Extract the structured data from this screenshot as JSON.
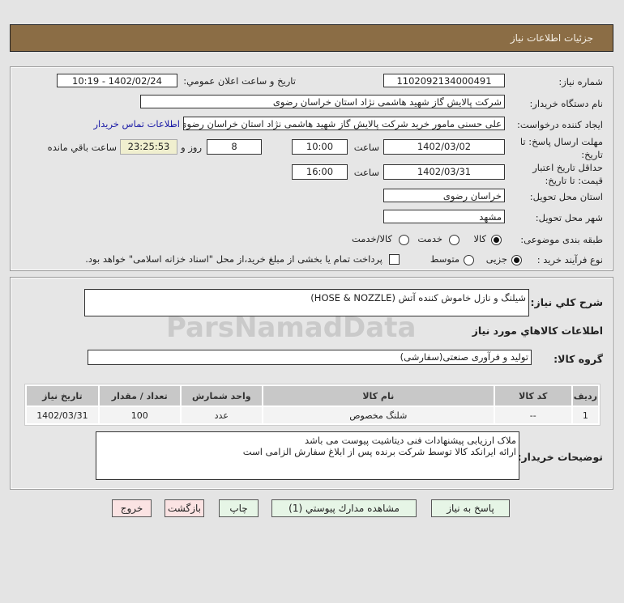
{
  "header": {
    "title": "جزئیات اطلاعات نیاز"
  },
  "watermark": "ParsNamadData",
  "form": {
    "need_number_label": "شماره نیاز:",
    "need_number": "1102092134000491",
    "announce_label": "تاریخ و ساعت اعلان عمومي:",
    "announce_value": "1402/02/24 - 10:19",
    "buyer_org_label": "نام دستگاه خریدار:",
    "buyer_org": "شرکت پالایش گاز شهید هاشمی نژاد   استان خراسان رضوی",
    "creator_label": "ایجاد کننده درخواست:",
    "creator": "علی حسنی مامور خرید شرکت پالایش گاز شهید هاشمی نژاد   استان خراسان رضوی",
    "contact_link": "اطلاعات تماس خریدار",
    "deadline_label_1": "مهلت ارسال پاسخ: تا",
    "deadline_label_2": "تاریخ:",
    "deadline_date": "1402/03/02",
    "time_label": "ساعت",
    "deadline_time": "10:00",
    "days": "8",
    "days_label": "روز و",
    "remaining": "23:25:53",
    "remaining_label": "ساعت باقي مانده",
    "validity_label_1": "حداقل تاریخ اعتبار",
    "validity_label_2": "قیمت: تا تاریخ:",
    "validity_date": "1402/03/31",
    "validity_time": "16:00",
    "province_label": "استان محل تحویل:",
    "province": "خراسان رضوی",
    "city_label": "شهر محل تحویل:",
    "city": "مشهد",
    "category_label": "طبقه بندی موضوعی:",
    "category_options": [
      {
        "label": "کالا",
        "selected": true
      },
      {
        "label": "خدمت",
        "selected": false
      },
      {
        "label": "کالا/خدمت",
        "selected": false
      }
    ],
    "process_label": "نوع فرآیند خرید :",
    "process_options": [
      {
        "label": "جزیی",
        "selected": true
      },
      {
        "label": "متوسط",
        "selected": false
      }
    ],
    "payment_note": "پرداخت تمام یا بخشی از مبلغ خرید،از محل \"اسناد خزانه اسلامی\" خواهد بود.",
    "payment_checked": false
  },
  "details": {
    "summary_label": "شرح کلي نیاز:",
    "summary": "شیلنگ و نازل خاموش کننده آتش (HOSE & NOZZLE)",
    "goods_info_label": "اطلاعات کالاهاي مورد نیاز",
    "group_label": "گروه کالا:",
    "group": "تولید و فرآوری صنعتی(سفارشی)",
    "table": {
      "columns": [
        "ردیف",
        "کد کالا",
        "نام کالا",
        "واحد شمارش",
        "تعداد / مقدار",
        "تاریخ نیاز"
      ],
      "rows": [
        [
          "1",
          "--",
          "شلنگ مخصوص",
          "عدد",
          "100",
          "1402/03/31"
        ]
      ]
    },
    "notes_label": "توضیحات خریدار:",
    "notes_line1": "ملاک ارزیابی پیشنهادات فنی دیتاشیت پیوست می باشد",
    "notes_line2": "ارائه ایرانکد کالا توسط شرکت برنده پس از ابلاغ سفارش الزامی است"
  },
  "buttons": {
    "reply": "پاسخ به نیاز",
    "attachments": "مشاهده مدارك پيوستي (1)",
    "print": "چاپ",
    "back": "بازگشت",
    "exit": "خروج"
  }
}
